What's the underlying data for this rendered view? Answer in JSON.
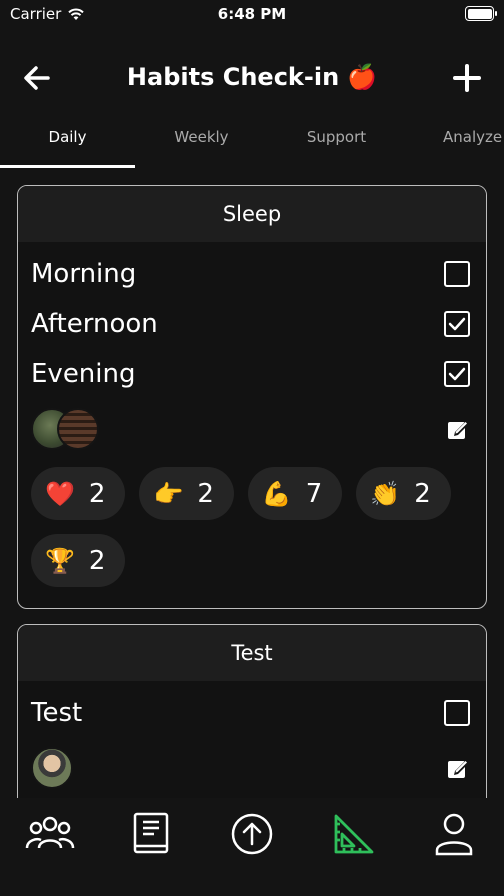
{
  "status_bar": {
    "carrier": "Carrier",
    "time": "6:48 PM"
  },
  "header": {
    "title": "Habits Check-in",
    "title_emoji": "🍎"
  },
  "tabs": [
    {
      "label": "Daily",
      "active": true
    },
    {
      "label": "Weekly",
      "active": false
    },
    {
      "label": "Support",
      "active": false
    },
    {
      "label": "Analyze",
      "active": false
    }
  ],
  "cards": [
    {
      "title": "Sleep",
      "items": [
        {
          "label": "Morning",
          "checked": false
        },
        {
          "label": "Afternoon",
          "checked": true
        },
        {
          "label": "Evening",
          "checked": true
        }
      ],
      "reactions": [
        {
          "emoji": "❤️",
          "count": "2"
        },
        {
          "emoji": "👉",
          "count": "2"
        },
        {
          "emoji": "💪",
          "count": "7"
        },
        {
          "emoji": "👏",
          "count": "2"
        },
        {
          "emoji": "🏆",
          "count": "2"
        }
      ]
    },
    {
      "title": "Test",
      "items": [
        {
          "label": "Test",
          "checked": false
        }
      ]
    }
  ],
  "colors": {
    "background": "#141414",
    "card_header": "#1e1e1e",
    "accent_green": "#2fbf5b"
  },
  "tab_bar_icons": [
    "group-icon",
    "journal-icon",
    "upload-icon",
    "analyze-icon",
    "profile-icon"
  ]
}
